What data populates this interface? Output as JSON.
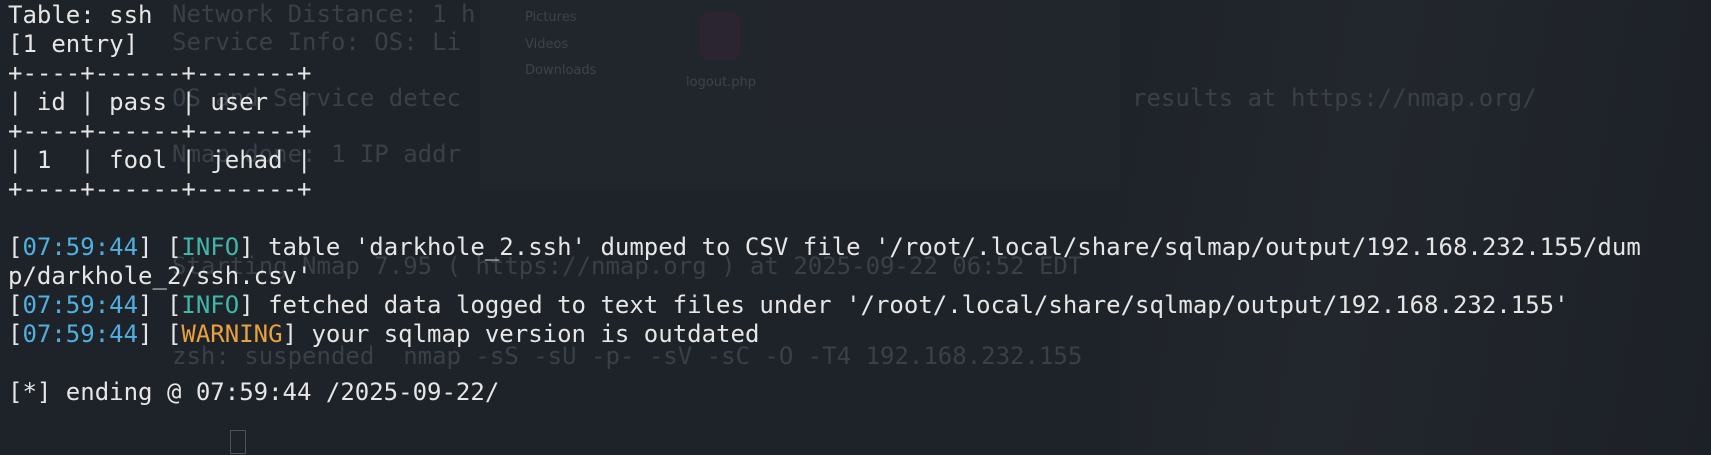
{
  "table": {
    "title": "Table: ssh",
    "entries": "[1 entry]",
    "border": "+----+------+-------+",
    "header_line": "| id | pass | user  |",
    "row_line": "| 1  | fool | jehad |"
  },
  "log": [
    {
      "time": "07:59:44",
      "level": "INFO",
      "message": " table 'darkhole_2.ssh' dumped to CSV file '/root/.local/share/sqlmap/output/192.168.232.155/dum",
      "continuation": "p/darkhole_2/ssh.csv'"
    },
    {
      "time": "07:59:44",
      "level": "INFO",
      "message": " fetched data logged to text files under '/root/.local/share/sqlmap/output/192.168.232.155'"
    },
    {
      "time": "07:59:44",
      "level": "WARNING",
      "message": " your sqlmap version is outdated"
    }
  ],
  "ending": "[*] ending @ 07:59:44 /2025-09-22/",
  "background_text": {
    "line1": "Network Distance: 1 h",
    "line2": "Service Info: OS: Li",
    "line3": "OS and Service detec",
    "line3b": "results at https://nmap.org/",
    "line4": "Nmap done: 1 IP addr",
    "line5": "Starting Nmap 7.95 ( https://nmap.org ) at 2025-09-22 06:52 EDT",
    "line6": "zsh: suspended  nmap -sS -sU -p- -sV -sC -O -T4 192.168.232.155",
    "sidebar_pictures": "Pictures",
    "sidebar_videos": "Videos",
    "sidebar_downloads": "Downloads",
    "file_name": "logout.php"
  },
  "colors": {
    "timestamp": "#4fb0e0",
    "info": "#3fb7a9",
    "warning": "#e9a23b",
    "background": "#1e2229",
    "text": "#e6e6e6"
  }
}
